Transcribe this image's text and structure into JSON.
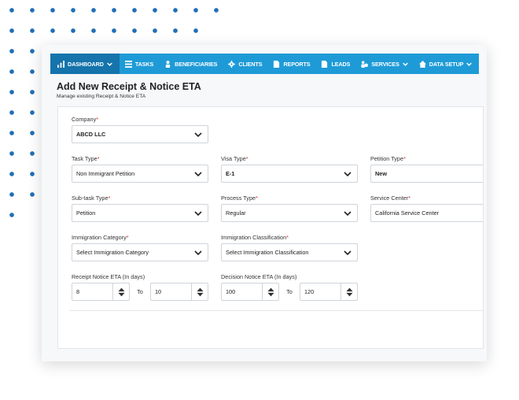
{
  "nav": {
    "items": [
      {
        "label": "DASHBOARD",
        "icon": "bar-chart-icon",
        "dropdown": true,
        "active": true
      },
      {
        "label": "TASKS",
        "icon": "tasks-icon",
        "dropdown": false
      },
      {
        "label": "BENEFICIARIES",
        "icon": "person-icon",
        "dropdown": false
      },
      {
        "label": "CLIENTS",
        "icon": "gear-icon",
        "dropdown": false
      },
      {
        "label": "REPORTS",
        "icon": "document-icon",
        "dropdown": false
      },
      {
        "label": "LEADS",
        "icon": "document-icon",
        "dropdown": false
      },
      {
        "label": "SERVICES",
        "icon": "user-group-icon",
        "dropdown": true
      },
      {
        "label": "DATA SETUP",
        "icon": "home-icon",
        "dropdown": true
      }
    ]
  },
  "page": {
    "title": "Add New Receipt & Notice ETA",
    "subtitle": "Manage existing Receipt & Notice ETA"
  },
  "form": {
    "company": {
      "label": "Company",
      "value": "ABCD LLC"
    },
    "task_type": {
      "label": "Task Type",
      "value": "Non Immigrant Petition"
    },
    "visa_type": {
      "label": "Visa Type",
      "value": "E-1"
    },
    "petition_type": {
      "label": "Petition Type",
      "value": "New"
    },
    "subtask_type": {
      "label": "Sub-task Type",
      "value": "Petition"
    },
    "process_type": {
      "label": "Process Type",
      "value": "Regular"
    },
    "service_center": {
      "label": "Service Center",
      "value": "California Service Center"
    },
    "immigration_category": {
      "label": "Immigration Category",
      "value": "Select Immigration Category"
    },
    "immigration_classification": {
      "label": "Immigration Classification",
      "value": "Select Immigration Classification"
    },
    "receipt_eta": {
      "label": "Receipt Notice ETA (In days)",
      "from": "8",
      "to_label": "To",
      "to": "10"
    },
    "decision_eta": {
      "label": "Decision Notice ETA (In days)",
      "from": "100",
      "to_label": "To",
      "to": "120"
    },
    "required_mark": "*"
  },
  "colors": {
    "navbar": "#1e9bd7",
    "navbar_active": "#1474ab",
    "dots": "#1f6fb8",
    "required": "#e0332f"
  }
}
